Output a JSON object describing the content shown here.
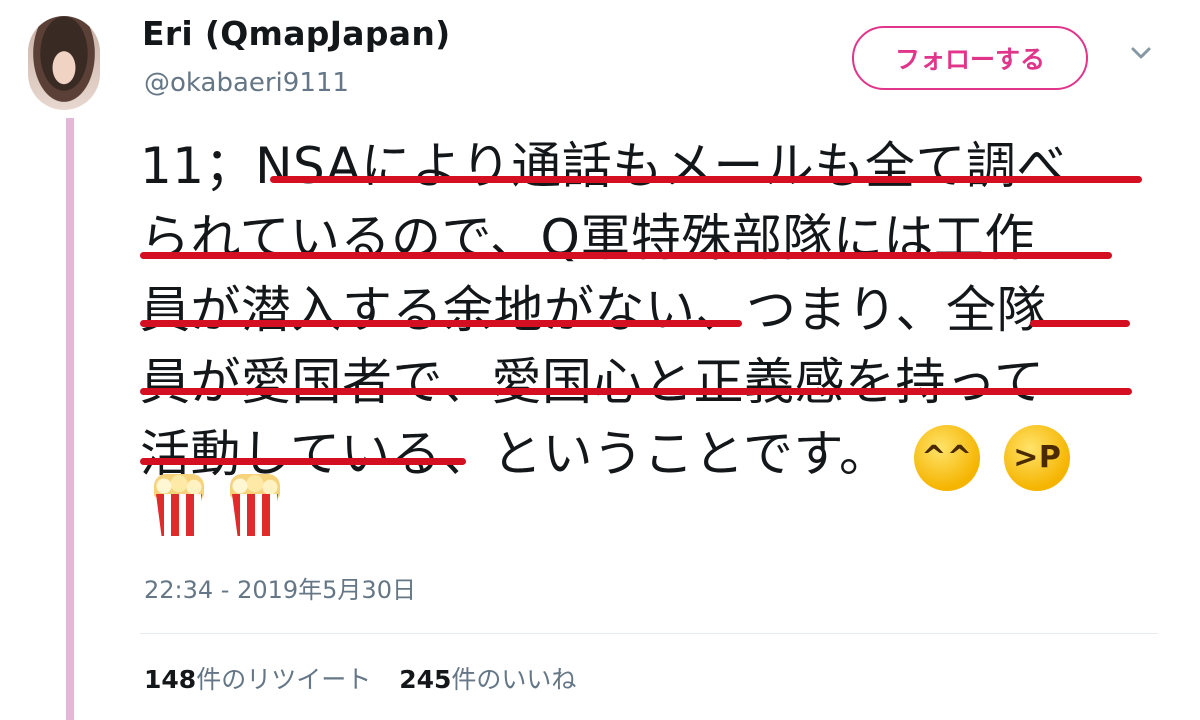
{
  "user": {
    "display_name": "Eri (QmapJapan)",
    "handle": "@okabaeri9111"
  },
  "actions": {
    "follow_label": "フォローする"
  },
  "tweet": {
    "lines": [
      "11；NSAにより通話もメールも全て調べ",
      "られているので、Q軍特殊部隊には工作",
      "員が潜入する余地がない、つまり、全隊",
      "員が愛国者で、愛国心と正義感を持って",
      "活動している、ということです。"
    ],
    "emoji_end": [
      "grinning-squinting-face",
      "squinting-face-with-tongue"
    ],
    "emoji_second_row": [
      "popcorn",
      "popcorn"
    ],
    "timestamp": "22:34 - 2019年5月30日"
  },
  "stats": {
    "retweet_count": "148",
    "retweet_label": "件のリツイート",
    "like_count": "245",
    "like_label": "件のいいね"
  },
  "colors": {
    "accent": "#e0358a",
    "underline": "#d40f22",
    "thread_line": "#e4b7d6"
  }
}
